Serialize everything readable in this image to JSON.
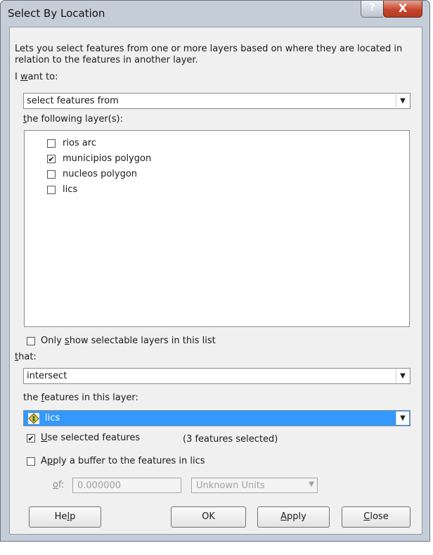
{
  "window": {
    "title": "Select By Location",
    "help_glyph": "?",
    "close_glyph": "X"
  },
  "description": "Lets you select features from one or more layers based on where they are located in relation to the features in another layer.",
  "want_to": {
    "label_pre": "I ",
    "label_u": "w",
    "label_post": "ant to:",
    "value": "select features from"
  },
  "layers": {
    "label_pre": "",
    "label_u": "t",
    "label_post": "he following layer(s):",
    "items": [
      {
        "label": "rios arc",
        "checked": false
      },
      {
        "label": "municipios polygon",
        "checked": true
      },
      {
        "label": "nucleos polygon",
        "checked": false
      },
      {
        "label": "lics",
        "checked": false
      }
    ]
  },
  "only_selectable": {
    "label_pre": "Only ",
    "label_u": "s",
    "label_post": "how selectable layers in this list",
    "checked": false
  },
  "that": {
    "label_pre": "",
    "label_u": "t",
    "label_post": "hat:",
    "value": "intersect"
  },
  "source_layer": {
    "label_pre": "the ",
    "label_u": "f",
    "label_post": "eatures in this layer:",
    "value": "lics",
    "icon": "layer-diamond-icon",
    "highlight_color": "#3399ff"
  },
  "use_selected": {
    "label_pre": "",
    "label_u": "U",
    "label_post": "se selected features",
    "checked": true,
    "count_text": "(3 features selected)"
  },
  "buffer": {
    "label_pre": "A",
    "label_u": "p",
    "label_post": "ply a buffer to the features in lics",
    "checked": false,
    "of_pre": "",
    "of_u": "o",
    "of_post": "f:",
    "distance": "0.000000",
    "units": "Unknown Units"
  },
  "buttons": {
    "help_pre": "He",
    "help_u": "l",
    "help_post": "p",
    "ok": "OK",
    "apply_pre": "",
    "apply_u": "A",
    "apply_post": "pply",
    "close_pre": "",
    "close_u": "C",
    "close_post": "lose"
  }
}
